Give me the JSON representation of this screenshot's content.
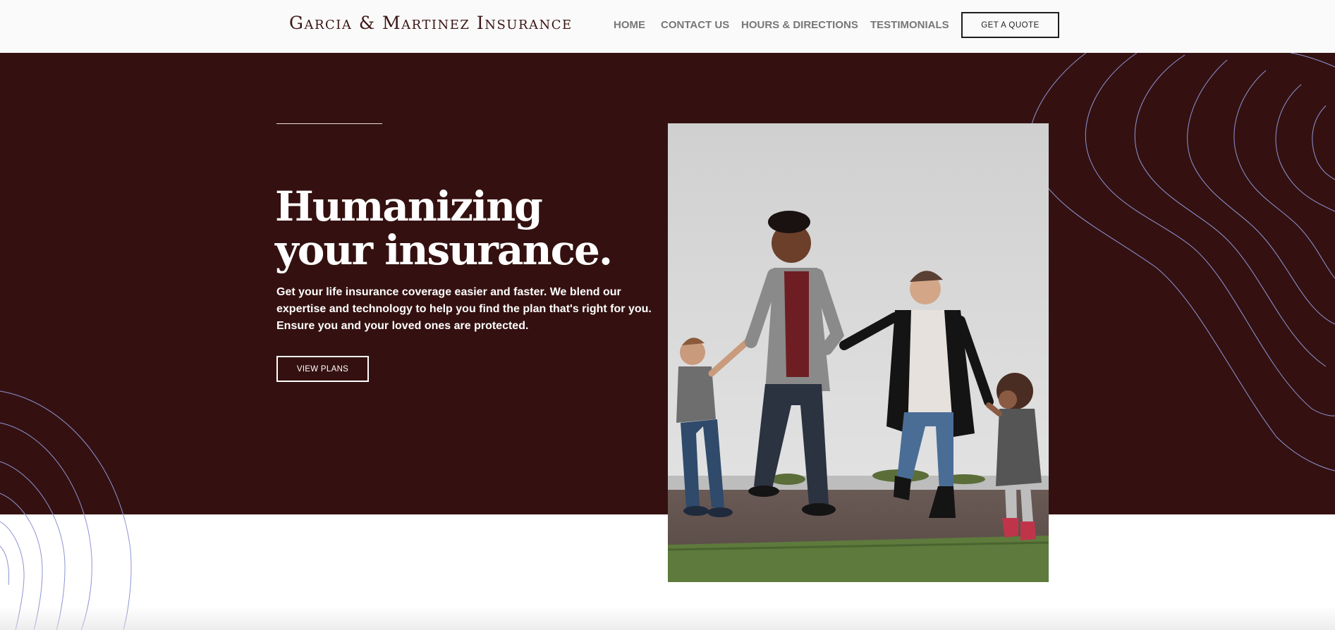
{
  "header": {
    "logo": "Garcia & Martinez Insurance",
    "nav": {
      "home": "HOME",
      "contact": "CONTACT US",
      "hours": "HOURS & DIRECTIONS",
      "testimonials": "TESTIMONIALS"
    },
    "cta": "GET A QUOTE"
  },
  "hero": {
    "title": "Humanizing your insurance.",
    "body": "Get your life insurance coverage easier and faster. We blend our expertise and technology to help you find the plan that's right for you. Ensure you and your loved ones are protected.",
    "cta": "VIEW PLANS"
  },
  "colors": {
    "hero_bg": "#341110",
    "header_bg": "#fafafa",
    "contour_lines": "#8e94d6"
  }
}
